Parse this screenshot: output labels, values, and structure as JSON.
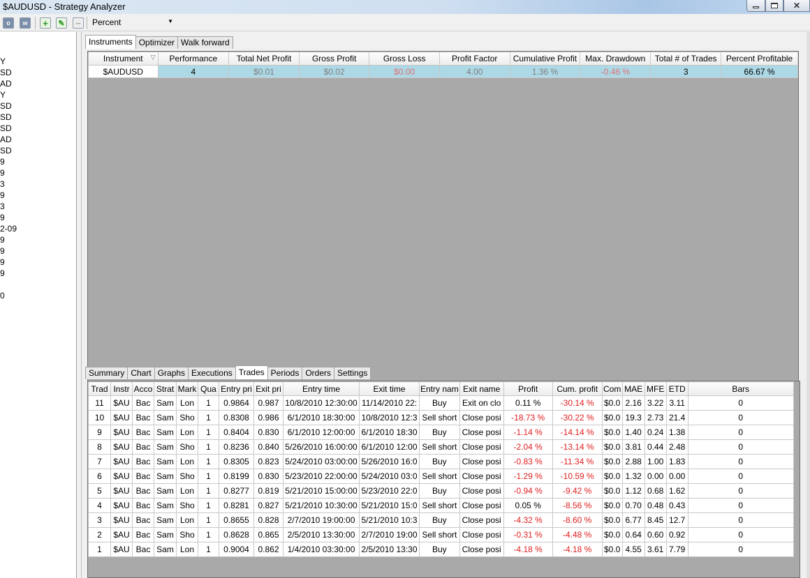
{
  "window": {
    "title": "$AUDUSD - Strategy Analyzer"
  },
  "toolbar": {
    "o_label": "o",
    "w_label": "w",
    "display_mode": "Percent"
  },
  "left_list": [
    "Y",
    "SD",
    "AD",
    "Y",
    "SD",
    "SD",
    "SD",
    "AD",
    "SD",
    "9",
    "9",
    "3",
    "9",
    "3",
    "9",
    "2-09",
    "9",
    "9",
    "9",
    "9",
    "0"
  ],
  "top_tabs": [
    "Instruments",
    "Optimizer",
    "Walk forward"
  ],
  "instruments": {
    "columns": [
      "Instrument",
      "Performance",
      "Total Net Profit",
      "Gross Profit",
      "Gross Loss",
      "Profit Factor",
      "Cumulative Profit",
      "Max. Drawdown",
      "Total # of Trades",
      "Percent Profitable"
    ],
    "row": {
      "instrument": "$AUDUSD",
      "performance": "4",
      "total_net_profit": "$0.01",
      "gross_profit": "$0.02",
      "gross_loss": "$0.00",
      "profit_factor": "4.00",
      "cumulative_profit": "1.36 %",
      "max_drawdown": "-0.46 %",
      "total_trades": "3",
      "percent_profitable": "66.67 %"
    }
  },
  "bottom_tabs": [
    "Summary",
    "Chart",
    "Graphs",
    "Executions",
    "Trades",
    "Periods",
    "Orders",
    "Settings"
  ],
  "trades": {
    "columns": [
      "Trad",
      "Instr",
      "Acco",
      "Strat",
      "Mark",
      "Qua",
      "Entry pri",
      "Exit pri",
      "Entry time",
      "Exit time",
      "Entry nam",
      "Exit name",
      "Profit",
      "Cum. profit",
      "Com",
      "MAE",
      "MFE",
      "ETD",
      "Bars"
    ],
    "rows": [
      [
        "11",
        "$AU",
        "Bac",
        "Sam",
        "Lon",
        "1",
        "0.9864",
        "0.987",
        "10/8/2010 12:30:00",
        "11/14/2010 22:",
        "Buy",
        "Exit on clo",
        "0.11 %",
        "-30.14 %",
        "$0.0",
        "2.16",
        "3.22",
        "3.11",
        "0"
      ],
      [
        "10",
        "$AU",
        "Bac",
        "Sam",
        "Sho",
        "1",
        "0.8308",
        "0.986",
        "6/1/2010 18:30:00",
        "10/8/2010 12:3",
        "Sell short",
        "Close posi",
        "-18.73 %",
        "-30.22 %",
        "$0.0",
        "19.3",
        "2.73",
        "21.4",
        "0"
      ],
      [
        "9",
        "$AU",
        "Bac",
        "Sam",
        "Lon",
        "1",
        "0.8404",
        "0.830",
        "6/1/2010 12:00:00",
        "6/1/2010 18:30",
        "Buy",
        "Close posi",
        "-1.14 %",
        "-14.14 %",
        "$0.0",
        "1.40",
        "0.24",
        "1.38",
        "0"
      ],
      [
        "8",
        "$AU",
        "Bac",
        "Sam",
        "Sho",
        "1",
        "0.8236",
        "0.840",
        "5/26/2010 16:00:00",
        "6/1/2010 12:00",
        "Sell short",
        "Close posi",
        "-2.04 %",
        "-13.14 %",
        "$0.0",
        "3.81",
        "0.44",
        "2.48",
        "0"
      ],
      [
        "7",
        "$AU",
        "Bac",
        "Sam",
        "Lon",
        "1",
        "0.8305",
        "0.823",
        "5/24/2010 03:00:00",
        "5/26/2010 16:0",
        "Buy",
        "Close posi",
        "-0.83 %",
        "-11.34 %",
        "$0.0",
        "2.88",
        "1.00",
        "1.83",
        "0"
      ],
      [
        "6",
        "$AU",
        "Bac",
        "Sam",
        "Sho",
        "1",
        "0.8199",
        "0.830",
        "5/23/2010 22:00:00",
        "5/24/2010 03:0",
        "Sell short",
        "Close posi",
        "-1.29 %",
        "-10.59 %",
        "$0.0",
        "1.32",
        "0.00",
        "0.00",
        "0"
      ],
      [
        "5",
        "$AU",
        "Bac",
        "Sam",
        "Lon",
        "1",
        "0.8277",
        "0.819",
        "5/21/2010 15:00:00",
        "5/23/2010 22:0",
        "Buy",
        "Close posi",
        "-0.94 %",
        "-9.42 %",
        "$0.0",
        "1.12",
        "0.68",
        "1.62",
        "0"
      ],
      [
        "4",
        "$AU",
        "Bac",
        "Sam",
        "Sho",
        "1",
        "0.8281",
        "0.827",
        "5/21/2010 10:30:00",
        "5/21/2010 15:0",
        "Sell short",
        "Close posi",
        "0.05 %",
        "-8.56 %",
        "$0.0",
        "0.70",
        "0.48",
        "0.43",
        "0"
      ],
      [
        "3",
        "$AU",
        "Bac",
        "Sam",
        "Lon",
        "1",
        "0.8655",
        "0.828",
        "2/7/2010 19:00:00",
        "5/21/2010 10:3",
        "Buy",
        "Close posi",
        "-4.32 %",
        "-8.60 %",
        "$0.0",
        "6.77",
        "8.45",
        "12.7",
        "0"
      ],
      [
        "2",
        "$AU",
        "Bac",
        "Sam",
        "Sho",
        "1",
        "0.8628",
        "0.865",
        "2/5/2010 13:30:00",
        "2/7/2010 19:00",
        "Sell short",
        "Close posi",
        "-0.31 %",
        "-4.48 %",
        "$0.0",
        "0.64",
        "0.60",
        "0.92",
        "0"
      ],
      [
        "1",
        "$AU",
        "Bac",
        "Sam",
        "Lon",
        "1",
        "0.9004",
        "0.862",
        "1/4/2010 03:30:00",
        "2/5/2010 13:30",
        "Buy",
        "Close posi",
        "-4.18 %",
        "-4.18 %",
        "$0.0",
        "4.55",
        "3.61",
        "7.79",
        "0"
      ]
    ]
  },
  "colors": {
    "selected_row": "#add8e6",
    "negative": "#e02020",
    "grid_bg": "#a9a9a9"
  }
}
